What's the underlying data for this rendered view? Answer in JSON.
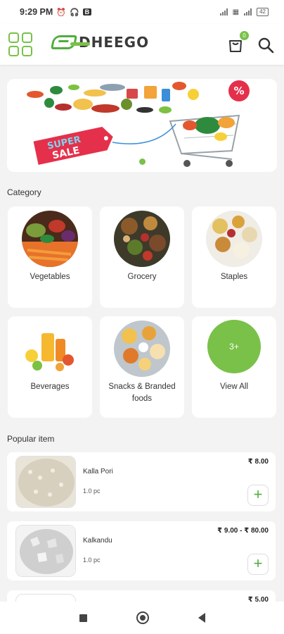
{
  "status_bar": {
    "time": "9:29 PM",
    "icons": [
      "alarm-icon",
      "headphones-icon",
      "b-notification-icon",
      "signal-icon",
      "volte-icon",
      "wifi-icon"
    ],
    "b_badge": "B",
    "battery": "42"
  },
  "header": {
    "logo_text": "DHEEGO",
    "cart_count": "0",
    "accent_color": "#79c149"
  },
  "banner": {
    "sale_text": "SUPER SALE",
    "discount_badge": "%",
    "active_slide": 1
  },
  "category": {
    "title": "Category",
    "items": [
      {
        "label": "Vegetables",
        "icon": "vegetables-image"
      },
      {
        "label": "Grocery",
        "icon": "grocery-image"
      },
      {
        "label": "Staples",
        "icon": "staples-image"
      },
      {
        "label": "Beverages",
        "icon": "beverages-image"
      },
      {
        "label": "Snacks & Branded foods",
        "icon": "snacks-image"
      },
      {
        "label": "View All",
        "circle_text": "3+"
      }
    ]
  },
  "popular": {
    "title": "Popular item",
    "items": [
      {
        "name": "Kalla Pori",
        "qty": "1.0 pc",
        "price": "₹ 8.00"
      },
      {
        "name": "Kalkandu",
        "qty": "1.0 pc",
        "price": "₹ 9.00 - ₹ 80.00"
      },
      {
        "name": "",
        "qty": "",
        "price": "₹ 5.00"
      }
    ],
    "add_label": "+"
  }
}
